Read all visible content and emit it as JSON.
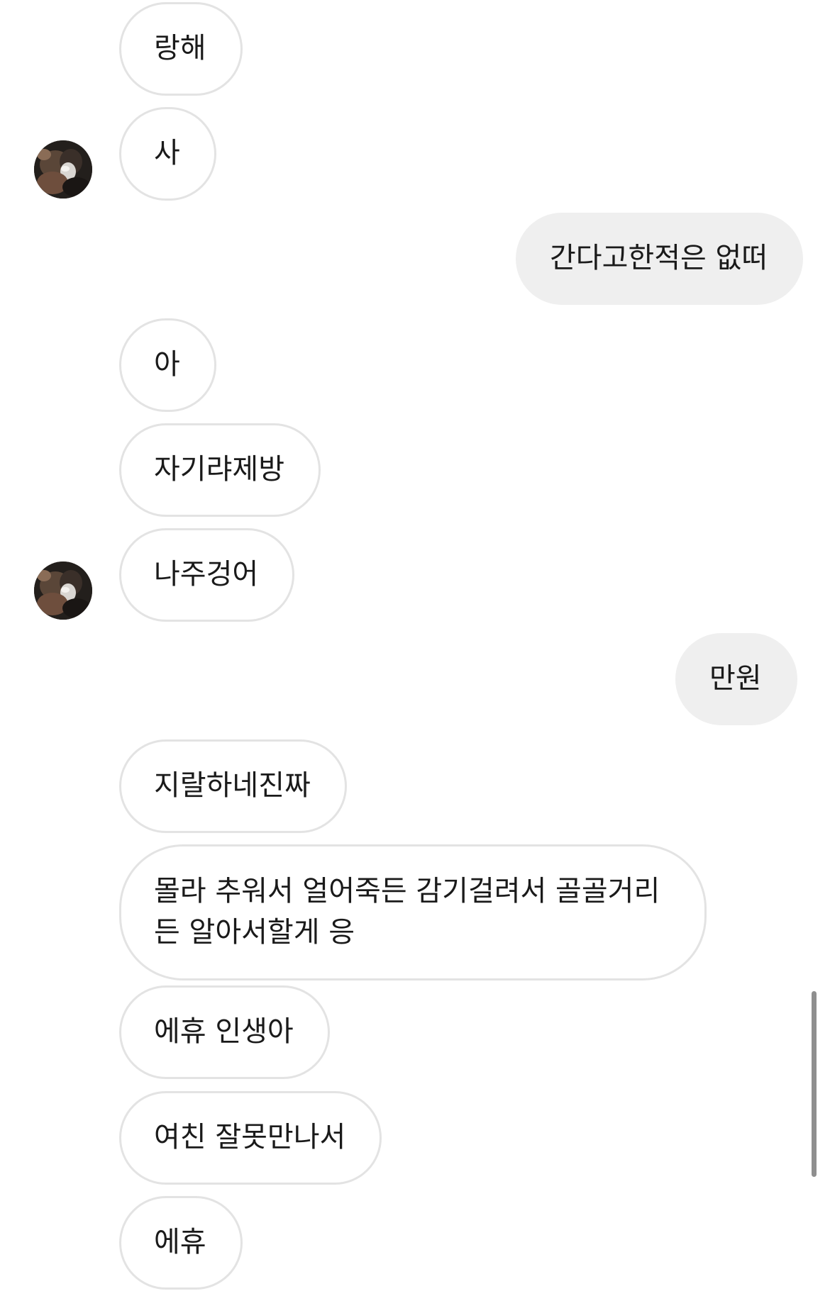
{
  "conversation": {
    "messages": [
      {
        "sender": "other",
        "text": "랑해"
      },
      {
        "sender": "other",
        "text": "사"
      },
      {
        "sender": "me",
        "text": "간다고한적은 없떠"
      },
      {
        "sender": "other",
        "text": "아"
      },
      {
        "sender": "other",
        "text": "자기랴제방"
      },
      {
        "sender": "other",
        "text": "나주겅어"
      },
      {
        "sender": "me",
        "text": "만원"
      },
      {
        "sender": "other",
        "text": "지랄하네진짜"
      },
      {
        "sender": "other",
        "text": "몰라 추워서 얼어죽든 감기걸려서 골골거리든 알아서할게 응"
      },
      {
        "sender": "other",
        "text": "에휴 인생아"
      },
      {
        "sender": "other",
        "text": "여친 잘못만나서"
      },
      {
        "sender": "other",
        "text": "에휴"
      }
    ]
  },
  "icons": {
    "avatar": "user-profile-photo"
  },
  "colors": {
    "incoming_bubble_bg": "#ffffff",
    "incoming_bubble_border": "#e3e3e3",
    "outgoing_bubble_bg": "#efefef",
    "text": "#1a1a1a",
    "scrollbar": "#8f8f8f"
  }
}
